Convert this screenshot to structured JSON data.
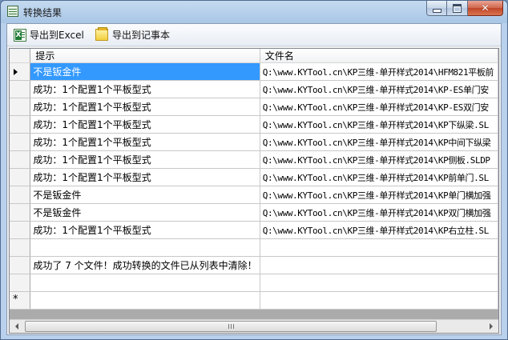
{
  "window": {
    "title": "转换结果"
  },
  "toolbar": {
    "export_excel_label": "导出到Excel",
    "export_notepad_label": "导出到记事本"
  },
  "grid": {
    "columns": [
      "提示",
      "文件名"
    ],
    "rows": [
      {
        "hint": "不是钣金件",
        "file": "Q:\\www.KYTool.cn\\KP三维-单开样式2014\\HFM821平板前",
        "selected": true
      },
      {
        "hint": "成功：1个配置1个平板型式",
        "file": "Q:\\www.KYTool.cn\\KP三维-单开样式2014\\KP-ES单门安"
      },
      {
        "hint": "成功：1个配置1个平板型式",
        "file": "Q:\\www.KYTool.cn\\KP三维-单开样式2014\\KP-ES双门安"
      },
      {
        "hint": "成功：1个配置1个平板型式",
        "file": "Q:\\www.KYTool.cn\\KP三维-单开样式2014\\KP下纵梁.SL"
      },
      {
        "hint": "成功：1个配置1个平板型式",
        "file": "Q:\\www.KYTool.cn\\KP三维-单开样式2014\\KP中间下纵梁"
      },
      {
        "hint": "成功：1个配置1个平板型式",
        "file": "Q:\\www.KYTool.cn\\KP三维-单开样式2014\\KP侧板.SLDP"
      },
      {
        "hint": "成功：1个配置1个平板型式",
        "file": "Q:\\www.KYTool.cn\\KP三维-单开样式2014\\KP前单门.SL"
      },
      {
        "hint": "不是钣金件",
        "file": "Q:\\www.KYTool.cn\\KP三维-单开样式2014\\KP单门横加强"
      },
      {
        "hint": "不是钣金件",
        "file": "Q:\\www.KYTool.cn\\KP三维-单开样式2014\\KP双门横加强"
      },
      {
        "hint": "成功：1个配置1个平板型式",
        "file": "Q:\\www.KYTool.cn\\KP三维-单开样式2014\\KP右立柱.SL"
      },
      {
        "hint": "",
        "file": ""
      },
      {
        "hint": "成功了 7 个文件！成功转换的文件已从列表中清除！",
        "file": ""
      },
      {
        "hint": "",
        "file": ""
      }
    ],
    "new_row_marker": "*"
  },
  "colors": {
    "selection": "#3399ff"
  }
}
